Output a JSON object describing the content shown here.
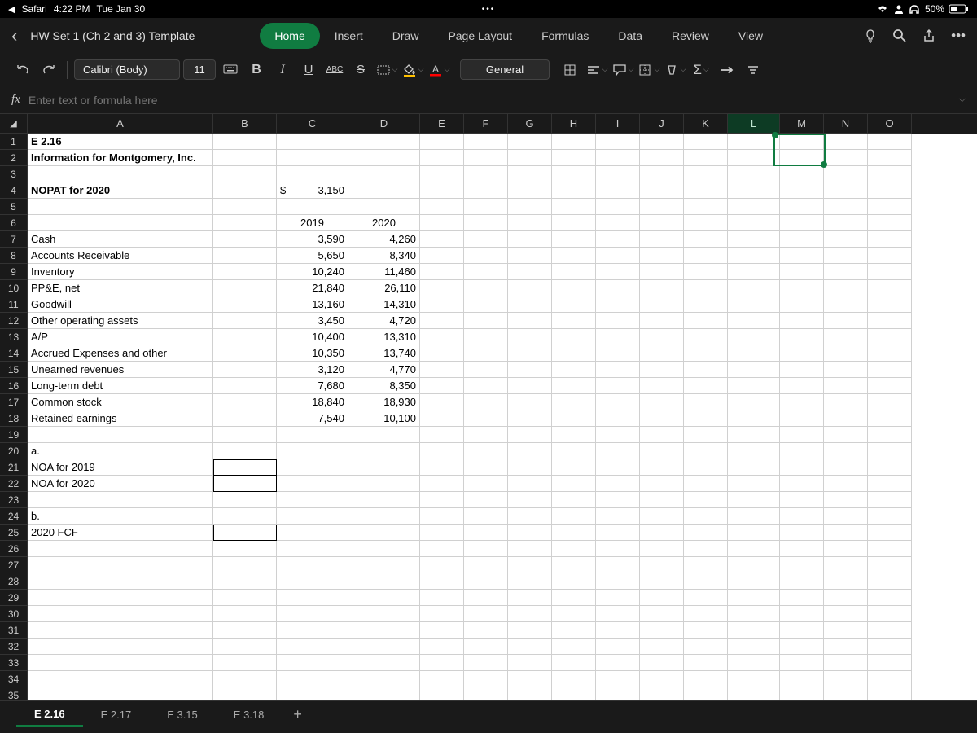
{
  "status": {
    "back_app": "Safari",
    "time": "4:22 PM",
    "date": "Tue Jan 30",
    "battery": "50%"
  },
  "header": {
    "doc_title": "HW Set 1 (Ch 2 and 3) Template",
    "tabs": [
      "Home",
      "Insert",
      "Draw",
      "Page Layout",
      "Formulas",
      "Data",
      "Review",
      "View"
    ],
    "active_tab": "Home"
  },
  "toolbar": {
    "font_name": "Calibri (Body)",
    "font_size": "11",
    "number_format": "General"
  },
  "formula_bar": {
    "fx": "fx",
    "placeholder": "Enter text or formula here"
  },
  "columns": [
    "A",
    "B",
    "C",
    "D",
    "E",
    "F",
    "G",
    "H",
    "I",
    "J",
    "K",
    "L",
    "M",
    "N",
    "O"
  ],
  "selected_col": "L",
  "row_count": 35,
  "cells": {
    "r1": {
      "A": "E 2.16"
    },
    "r2": {
      "A": "Information for Montgomery, Inc."
    },
    "r4": {
      "A": "NOPAT for 2020",
      "C_prefix": "$",
      "C": "3,150"
    },
    "r6": {
      "C": "2019",
      "D": "2020"
    },
    "r7": {
      "A": "Cash",
      "C": "3,590",
      "D": "4,260"
    },
    "r8": {
      "A": "Accounts Receivable",
      "C": "5,650",
      "D": "8,340"
    },
    "r9": {
      "A": "Inventory",
      "C": "10,240",
      "D": "11,460"
    },
    "r10": {
      "A": "PP&E, net",
      "C": "21,840",
      "D": "26,110"
    },
    "r11": {
      "A": "Goodwill",
      "C": "13,160",
      "D": "14,310"
    },
    "r12": {
      "A": "Other operating assets",
      "C": "3,450",
      "D": "4,720"
    },
    "r13": {
      "A": "A/P",
      "C": "10,400",
      "D": "13,310"
    },
    "r14": {
      "A": "Accrued Expenses and other",
      "C": "10,350",
      "D": "13,740"
    },
    "r15": {
      "A": "Unearned revenues",
      "C": "3,120",
      "D": "4,770"
    },
    "r16": {
      "A": "Long-term debt",
      "C": "7,680",
      "D": "8,350"
    },
    "r17": {
      "A": "Common stock",
      "C": "18,840",
      "D": "18,930"
    },
    "r18": {
      "A": "Retained earnings",
      "C": "7,540",
      "D": "10,100"
    },
    "r20": {
      "A": "a."
    },
    "r21": {
      "A": "NOA for 2019"
    },
    "r22": {
      "A": "NOA for 2020"
    },
    "r24": {
      "A": "b."
    },
    "r25": {
      "A": "2020 FCF"
    }
  },
  "sheets": {
    "tabs": [
      "E 2.16",
      "E 2.17",
      "E 3.15",
      "E 3.18"
    ],
    "active": "E 2.16"
  }
}
